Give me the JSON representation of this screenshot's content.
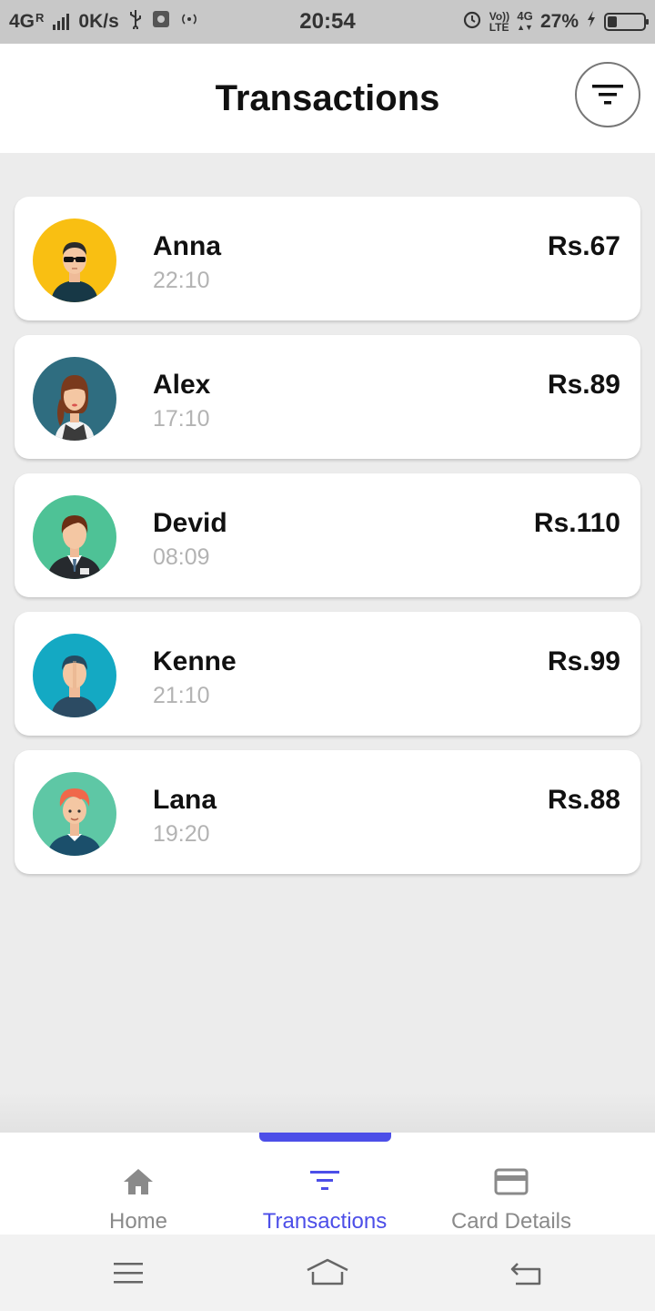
{
  "status_bar": {
    "network": "4G",
    "roaming": "R",
    "speed": "0K/s",
    "time": "20:54",
    "volte_top": "Vo))",
    "volte_bottom": "LTE",
    "net_type": "4G",
    "battery_percent": "27%",
    "battery_level": 0.27,
    "icons": [
      "usb-icon",
      "app-notification-icon",
      "hotspot-icon",
      "alarm-icon",
      "charging-icon"
    ]
  },
  "header": {
    "title": "Transactions",
    "filter_icon": "filter-icon"
  },
  "transactions": [
    {
      "name": "Anna",
      "time": "22:10",
      "amount": "Rs.67",
      "avatar_bg": "#f9bf12"
    },
    {
      "name": "Alex",
      "time": "17:10",
      "amount": "Rs.89",
      "avatar_bg": "#2f6d80"
    },
    {
      "name": "Devid",
      "time": "08:09",
      "amount": "Rs.110",
      "avatar_bg": "#4ec296"
    },
    {
      "name": "Kenne",
      "time": "21:10",
      "amount": "Rs.99",
      "avatar_bg": "#14a9c3"
    },
    {
      "name": "Lana",
      "time": "19:20",
      "amount": "Rs.88",
      "avatar_bg": "#5ec7a5"
    }
  ],
  "bottom_nav": {
    "active_color": "#4c4ee8",
    "inactive_color": "#8a8a8a",
    "items": [
      {
        "label": "Home",
        "icon": "home-icon",
        "active": false
      },
      {
        "label": "Transactions",
        "icon": "filter-icon",
        "active": true
      },
      {
        "label": "Card Details",
        "icon": "card-icon",
        "active": false
      }
    ]
  },
  "system_nav": {
    "icons": [
      "menu-icon",
      "home-outline-icon",
      "back-icon"
    ]
  }
}
